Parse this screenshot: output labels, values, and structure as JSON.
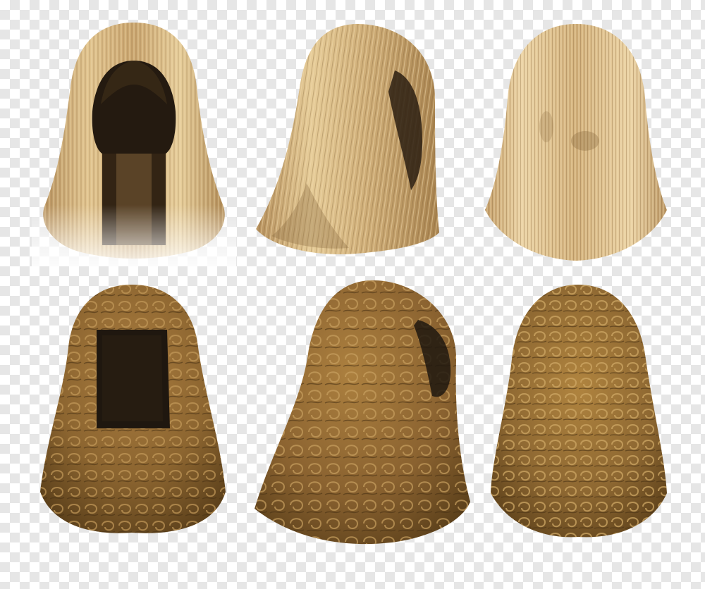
{
  "image": {
    "background": "transparency-checkerboard",
    "colors": {
      "checker_light": "#ffffff",
      "checker_dark": "#e6e6e6",
      "blonde_base": "#c9a46e",
      "blonde_highlight": "#ecd4a6",
      "blonde_shadow": "#8a6a3e",
      "brown_base": "#8c6530",
      "brown_highlight": "#c49a5a",
      "brown_shadow": "#4a3214",
      "interior_dark": "#1f170f"
    },
    "rows": [
      {
        "style": "straight blonde shoulder-length wig",
        "views": [
          "front",
          "three-quarter",
          "back"
        ]
      },
      {
        "style": "long curly brown wig",
        "views": [
          "front",
          "three-quarter",
          "back"
        ]
      }
    ]
  }
}
